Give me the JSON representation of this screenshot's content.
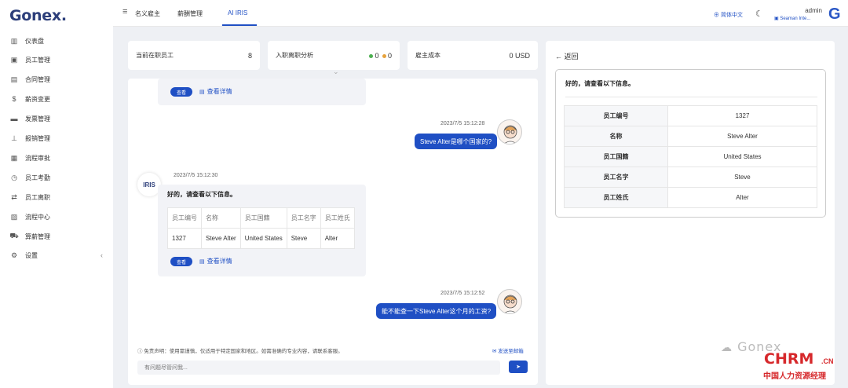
{
  "app": {
    "logo": "Gonex."
  },
  "sidebar": {
    "items": [
      {
        "icon": "▥",
        "label": "仪表盘"
      },
      {
        "icon": "▣",
        "label": "员工管理"
      },
      {
        "icon": "▤",
        "label": "合同管理"
      },
      {
        "icon": "$",
        "label": "薪资变更"
      },
      {
        "icon": "▬",
        "label": "发票管理"
      },
      {
        "icon": "⊥",
        "label": "报销管理"
      },
      {
        "icon": "▦",
        "label": "流程审批"
      },
      {
        "icon": "◷",
        "label": "员工考勤"
      },
      {
        "icon": "⇄",
        "label": "员工离职"
      },
      {
        "icon": "▨",
        "label": "流程中心"
      },
      {
        "icon": "⛟",
        "label": "算薪管理"
      },
      {
        "icon": "⚙",
        "label": "设置"
      }
    ],
    "collapse": "‹"
  },
  "topbar": {
    "menu_icon": "≡",
    "nav": [
      "名义雇主",
      "薪酬管理",
      "AI IRIS"
    ],
    "lang": "⊕ 简体中文",
    "theme_icon": "☾",
    "user": {
      "name": "admin",
      "company": "▣ Seaman Inte...",
      "avatar": "G"
    }
  },
  "stats": {
    "employees": {
      "label": "当前在职员工",
      "value": "8"
    },
    "resignation": {
      "label": "入职离职分析",
      "green": "0",
      "orange": "0"
    },
    "cost": {
      "label": "雇主成本",
      "value": "0 USD"
    },
    "expand": "⌄"
  },
  "chat": {
    "view_btn": "查看",
    "detail_link": "查看详情",
    "messages": [
      {
        "time": "2023/7/5 15:12:28",
        "text": "Steve Alter是哪个国家的?"
      },
      {
        "time": "2023/7/5 15:12:30",
        "sender": "IRIS",
        "text": "好的，请查看以下信息。"
      },
      {
        "time": "2023/7/5 15:12:52",
        "text": "能不能查一下Steve Alter这个月的工资?"
      }
    ],
    "table": {
      "headers": [
        "员工编号",
        "名称",
        "员工国籍",
        "员工名字",
        "员工姓氏"
      ],
      "row": [
        "1327",
        "Steve Alter",
        "United States",
        "Steve",
        "Alter"
      ]
    },
    "disclaimer": "ⓘ 免责声明：使用需谨慎，仅适用于特定国家和地区。如需准确的专业内容，请联系客服。",
    "email": "✉ 发送至邮箱",
    "input_placeholder": "有问题尽管问我...",
    "send_icon": "➤"
  },
  "detail": {
    "back": "← 返回",
    "title": "好的，请查看以下信息。",
    "rows": [
      {
        "key": "员工编号",
        "value": "1327"
      },
      {
        "key": "名称",
        "value": "Steve Alter"
      },
      {
        "key": "员工国籍",
        "value": "United States"
      },
      {
        "key": "员工名字",
        "value": "Steve"
      },
      {
        "key": "员工姓氏",
        "value": "Alter"
      }
    ]
  },
  "watermark": {
    "brand": "Gonex",
    "chrm": "CHRM",
    "chrm_suffix": ".CN",
    "chrm_sub": "中国人力资源经理"
  },
  "colors": {
    "accent": "#1f4fc4",
    "green_dot": "#4caf50",
    "orange_dot": "#e6a23c",
    "watermark_red": "#d6282b"
  }
}
